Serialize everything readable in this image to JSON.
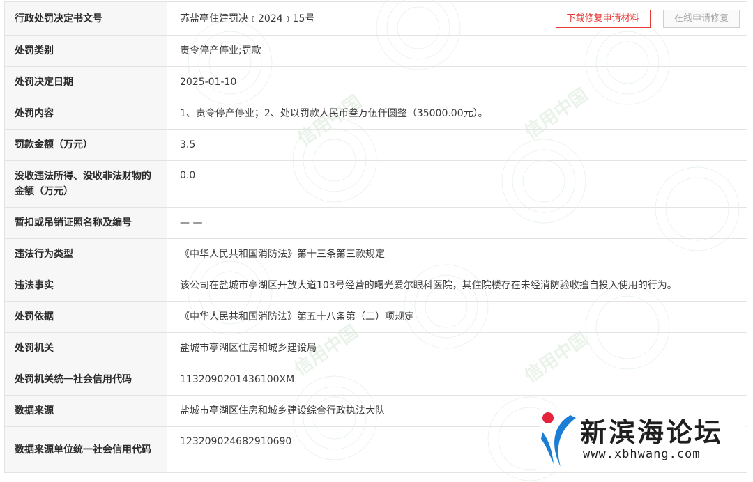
{
  "buttons": {
    "download_label": "下载修复申请材料",
    "online_repair_label": "在线申请修复"
  },
  "rows": [
    {
      "label": "行政处罚决定书文号",
      "value": "苏盐亭住建罚决﹝2024﹞15号"
    },
    {
      "label": "处罚类别",
      "value": "责令停产停业;罚款"
    },
    {
      "label": "处罚决定日期",
      "value": "2025-01-10"
    },
    {
      "label": "处罚内容",
      "value": "1、责令停产停业；2、处以罚款人民币叁万伍仟圆整（35000.00元）。"
    },
    {
      "label": "罚款金额（万元）",
      "value": "3.5"
    },
    {
      "label": "没收违法所得、没收非法财物的金额（万元）",
      "value": "0.0"
    },
    {
      "label": "暂扣或吊销证照名称及编号",
      "value": "— —"
    },
    {
      "label": "违法行为类型",
      "value": "《中华人民共和国消防法》第十三条第三款规定"
    },
    {
      "label": "违法事实",
      "value": "该公司在盐城市亭湖区开放大道103号经营的曙光爱尔眼科医院，其住院楼存在未经消防验收擅自投入使用的行为。"
    },
    {
      "label": "处罚依据",
      "value": "《中华人民共和国消防法》第五十八条第（二）项规定"
    },
    {
      "label": "处罚机关",
      "value": "盐城市亭湖区住房和城乡建设局"
    },
    {
      "label": "处罚机关统一社会信用代码",
      "value": "1132090201436100XM"
    },
    {
      "label": "数据来源",
      "value": "盐城市亭湖区住房和城乡建设综合行政执法大队"
    },
    {
      "label": "数据来源单位统一社会信用代码",
      "value": "123209024682910690"
    }
  ],
  "watermark": {
    "text": "信用中国"
  },
  "logo": {
    "title": "新滨海论坛",
    "url": "www.xbhwang.com",
    "accent_red": "#e5243b",
    "accent_blue": "#1a7fd4"
  },
  "colors": {
    "border": "#e3e3e3",
    "label_bg": "#f7f7f7",
    "download_button": "#e53935"
  }
}
